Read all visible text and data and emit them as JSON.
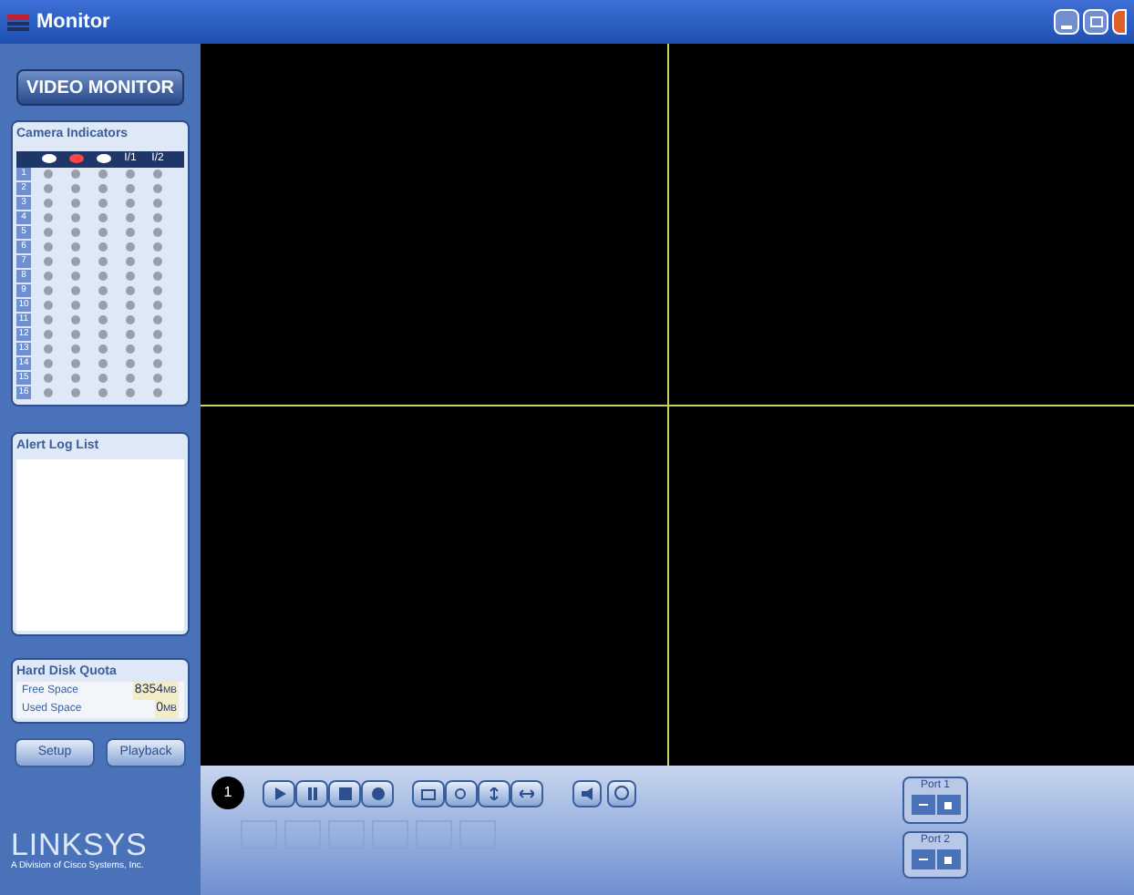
{
  "window": {
    "title": "Monitor"
  },
  "sidebar": {
    "mode_button": "VIDEO MONITOR",
    "camera_indicators": {
      "title": "Camera Indicators",
      "columns": [
        {
          "kind": "icon"
        },
        {
          "kind": "icon"
        },
        {
          "kind": "icon"
        },
        {
          "kind": "text",
          "label": "I/1"
        },
        {
          "kind": "text",
          "label": "I/2"
        }
      ],
      "rows": [
        "1",
        "2",
        "3",
        "4",
        "5",
        "6",
        "7",
        "8",
        "9",
        "10",
        "11",
        "12",
        "13",
        "14",
        "15",
        "16"
      ]
    },
    "alert_log": {
      "title": "Alert Log List"
    },
    "disk_quota": {
      "title": "Hard Disk Quota",
      "items": [
        {
          "label": "Free Space",
          "value": "8354",
          "unit": "MB"
        },
        {
          "label": "Used Space",
          "value": "0",
          "unit": "MB"
        }
      ]
    },
    "buttons": [
      "Setup",
      "Playback"
    ],
    "logo": {
      "name": "LINKSYS",
      "tagline": "A Division of Cisco Systems, Inc."
    }
  },
  "controls": {
    "channel": "1",
    "ports": [
      {
        "label": "Port 1"
      },
      {
        "label": "Port 2"
      }
    ]
  }
}
